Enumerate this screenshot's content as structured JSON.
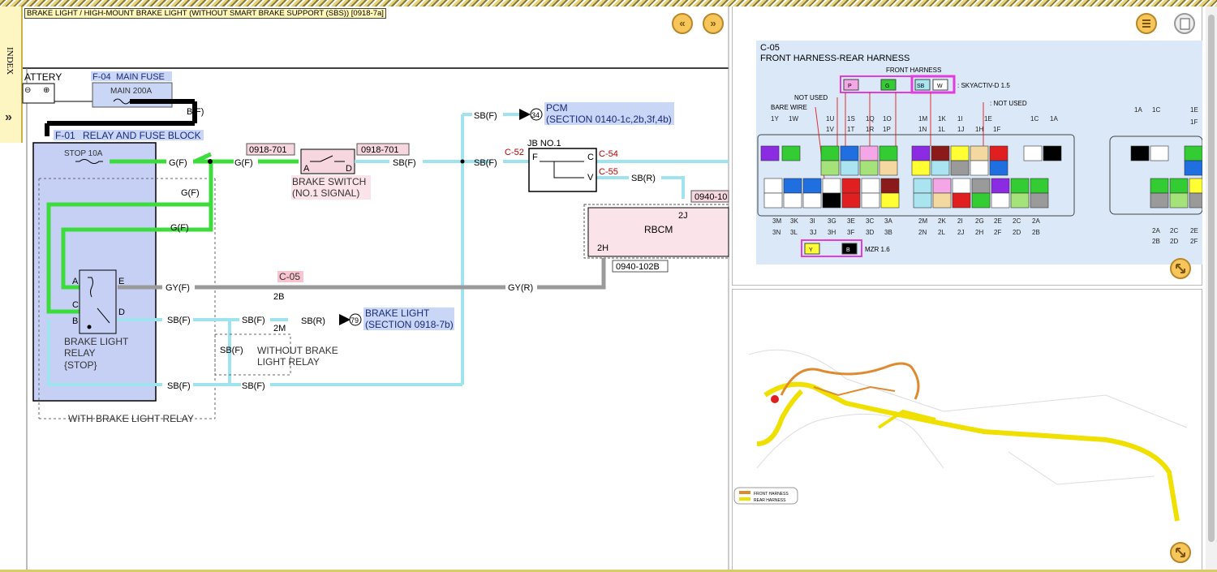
{
  "title": "BRAKE LIGHT / HIGH-MOUNT BRAKE LIGHT (WITHOUT SMART BRAKE SUPPORT (SBS)) [0918-7a]",
  "index_tab": {
    "label": "INDEX",
    "arrow": "»"
  },
  "nav": {
    "prev": "«",
    "next": "»"
  },
  "diagram": {
    "battery": "ATTERY",
    "main_fuse_id": "F-04",
    "main_fuse_name": "MAIN FUSE",
    "main_fuse_rating": "MAIN 200A",
    "bf_label": "B(F)",
    "relay_block_id": "F-01",
    "relay_block_name": "RELAY AND FUSE BLOCK",
    "stop_fuse": "STOP 10A",
    "gf": "G(F)",
    "conn_0918_701": "0918-701",
    "sbf": "SB(F)",
    "sbr": "SB(R)",
    "gyf": "GY(F)",
    "gyr": "GY(R)",
    "brake_switch": "BRAKE SWITCH",
    "brake_switch_sub": "(NO.1 SIGNAL)",
    "pin_a": "A",
    "pin_d": "D",
    "pin_c": "C",
    "pin_b": "B",
    "pin_e": "E",
    "pin_f": "F",
    "pin_v": "V",
    "pcm_ref": "34",
    "pcm_label": "PCM",
    "pcm_section": "(SECTION 0140-1c,2b,3f,4b)",
    "jb_label": "JB NO.1",
    "c52": "C-52",
    "c54": "C-54",
    "c55": "C-55",
    "conn_0940_10": "0940-10",
    "pin_2j": "2J",
    "pin_2h": "2H",
    "rbcm": "RBCM",
    "conn_0940_102b": "0940-102B",
    "c05": "C-05",
    "pin_2b": "2B",
    "pin_2m": "2M",
    "brake_light_ref": "79",
    "brake_light_label": "BRAKE LIGHT",
    "brake_light_section": "(SECTION 0918-7b)",
    "relay_label_1": "BRAKE LIGHT",
    "relay_label_2": "RELAY",
    "relay_label_3": "{STOP}",
    "without_relay_1": "WITHOUT BRAKE",
    "without_relay_2": "LIGHT RELAY",
    "with_relay": "WITH BRAKE LIGHT RELAY"
  },
  "connector": {
    "id": "C-05",
    "name": "FRONT HARNESS-REAR HARNESS",
    "front_harness": "FRONT HARNESS",
    "skyactiv": ": SKYACTIV-D 1.5",
    "mzr": "MZR 1.6",
    "not_used": "NOT USED",
    "not_used_2": ": NOT USED",
    "bare_wire": "BARE WIRE",
    "top_legend": [
      "P",
      "G",
      "SB",
      "W"
    ],
    "mzr_legend": [
      "Y",
      "B"
    ],
    "pins_row1": [
      "1Y",
      "1W",
      "1U",
      "1S",
      "1Q",
      "1O",
      "1M",
      "1K",
      "1I",
      "1E",
      "1C",
      "1A"
    ],
    "pins_row2": [
      "1V",
      "1T",
      "1R",
      "1P",
      "1N",
      "1L",
      "1J",
      "1H",
      "1F"
    ],
    "pins_row3": [
      "3M",
      "3K",
      "3I",
      "3G",
      "3E",
      "3C",
      "3A",
      "2M",
      "2K",
      "2I",
      "2G",
      "2E",
      "2C",
      "2A"
    ],
    "pins_row4": [
      "3N",
      "3L",
      "3J",
      "3H",
      "3F",
      "3D",
      "3B",
      "2N",
      "2L",
      "2J",
      "2H",
      "2F",
      "2D",
      "2B"
    ],
    "right_pins_top": [
      "1A",
      "1C",
      "1E",
      "1F"
    ],
    "right_pins_bot": [
      "2A",
      "2C",
      "2E",
      "2B",
      "2D",
      "2F"
    ],
    "colors": {
      "V": "#8b2be2",
      "G": "#33cc33",
      "W": "#ffffff",
      "B": "#000000",
      "L": "#1f6fe0",
      "P": "#f4a6e6",
      "LG": "#a6e27a",
      "SB": "#a9e4f0",
      "T": "#f3d9a0",
      "BR": "#8b1a1a",
      "Y": "#ffff33",
      "R": "#e02020",
      "GY": "#9a9a9a"
    }
  },
  "harness_legend": {
    "front": "FRONT HARNESS",
    "rear": "REAR HARNESS"
  }
}
